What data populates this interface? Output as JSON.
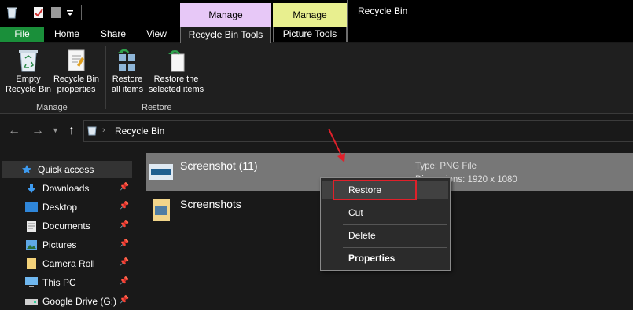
{
  "window": {
    "title": "Recycle Bin"
  },
  "context_tabs": {
    "recycle_group": "Manage",
    "picture_group": "Manage"
  },
  "tabs": {
    "file": "File",
    "home": "Home",
    "share": "Share",
    "view": "View",
    "recycle_tools": "Recycle Bin Tools",
    "picture_tools": "Picture Tools"
  },
  "ribbon": {
    "empty_line1": "Empty",
    "empty_line2": "Recycle Bin",
    "props_line1": "Recycle Bin",
    "props_line2": "properties",
    "restore_all_line1": "Restore",
    "restore_all_line2": "all items",
    "restore_sel_line1": "Restore the",
    "restore_sel_line2": "selected items",
    "group_manage": "Manage",
    "group_restore": "Restore"
  },
  "address": {
    "path": "Recycle Bin"
  },
  "nav": {
    "items": [
      {
        "label": "Quick access",
        "icon": "star-icon"
      },
      {
        "label": "Downloads",
        "icon": "download-icon",
        "pinned": true
      },
      {
        "label": "Desktop",
        "icon": "desktop-icon",
        "pinned": true
      },
      {
        "label": "Documents",
        "icon": "documents-icon",
        "pinned": true
      },
      {
        "label": "Pictures",
        "icon": "pictures-icon",
        "pinned": true
      },
      {
        "label": "Camera Roll",
        "icon": "folder-icon",
        "pinned": true
      },
      {
        "label": "This PC",
        "icon": "computer-icon",
        "pinned": true
      },
      {
        "label": "Google Drive (G:)",
        "icon": "drive-icon",
        "pinned": true
      }
    ]
  },
  "files": [
    {
      "name": "Screenshot (11)",
      "type_label": "Type: PNG File",
      "dims_label": "Dimensions: 1920 x 1080",
      "selected": true
    },
    {
      "name": "Screenshots"
    }
  ],
  "context_menu": {
    "restore": "Restore",
    "cut": "Cut",
    "delete": "Delete",
    "properties": "Properties"
  },
  "colors": {
    "file_tab": "#1a8f3a",
    "recycle_context": "#e7c8f7",
    "picture_context": "#e8ef8f",
    "highlight_box": "#e0202a",
    "arrow": "#e0202a"
  }
}
